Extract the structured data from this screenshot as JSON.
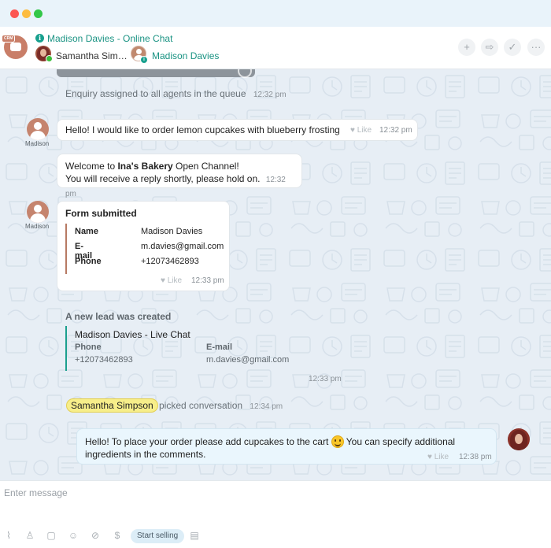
{
  "header": {
    "title": "Madison Davies - Online Chat",
    "crm_tag": "CRM",
    "participants": [
      "Samantha Sim…",
      "Madison Davies"
    ],
    "actions": [
      {
        "name": "add",
        "glyph": "+"
      },
      {
        "name": "forward",
        "glyph": "⇨"
      },
      {
        "name": "complete",
        "glyph": "✓"
      },
      {
        "name": "more",
        "glyph": "···"
      }
    ]
  },
  "messages": {
    "system_assigned": {
      "text": "Enquiry assigned to all agents in the queue",
      "time": "12:32 pm"
    },
    "customer_1": {
      "author": "Madison",
      "text": "Hello! I would like to order lemon cupcakes with blueberry frosting",
      "like": "Like",
      "time": "12:32 pm"
    },
    "welcome": {
      "prefix": "Welcome to ",
      "bold": "Ina's Bakery",
      "suffix": " Open Channel!",
      "line2": "You will receive a reply shortly, please hold on.",
      "time": "12:32 pm"
    },
    "form": {
      "author": "Madison",
      "title": "Form submitted",
      "rows": [
        {
          "label": "Name",
          "value": "Madison Davies"
        },
        {
          "label": "E-mail",
          "value": "m.davies@gmail.com"
        },
        {
          "label": "Phone",
          "value": "+12073462893"
        }
      ],
      "like": "Like",
      "time": "12:33 pm"
    },
    "lead": {
      "title": "A new lead was created",
      "name": "Madison Davies - Live Chat",
      "phone_label": "Phone",
      "phone": "+12073462893",
      "email_label": "E-mail",
      "email": "m.davies@gmail.com",
      "time": "12:33 pm"
    },
    "picked": {
      "agent": "Samantha Simpson",
      "text": "picked conversation",
      "time": "12:34 pm"
    },
    "agent_reply": {
      "text_before": "Hello! To place your order please add cupcakes to the cart",
      "text_after": " You can specify additional",
      "line2": "ingredients in the comments.",
      "like": "Like",
      "time": "12:38 pm"
    }
  },
  "composer": {
    "placeholder": "Enter message",
    "start_selling": "Start selling",
    "tools": [
      {
        "name": "attach",
        "glyph": "⌇"
      },
      {
        "name": "user",
        "glyph": "♙"
      },
      {
        "name": "template",
        "glyph": "▢"
      },
      {
        "name": "emoji",
        "glyph": "☺"
      },
      {
        "name": "hidden",
        "glyph": "⊘"
      },
      {
        "name": "payment",
        "glyph": "$"
      },
      {
        "name": "document",
        "glyph": "▤"
      }
    ]
  },
  "colors": {
    "accent": "#1a9383",
    "chat_bg": "#e7eef5",
    "agent_bubble": "#eaf6fd",
    "highlight": "#f7ee8a"
  }
}
